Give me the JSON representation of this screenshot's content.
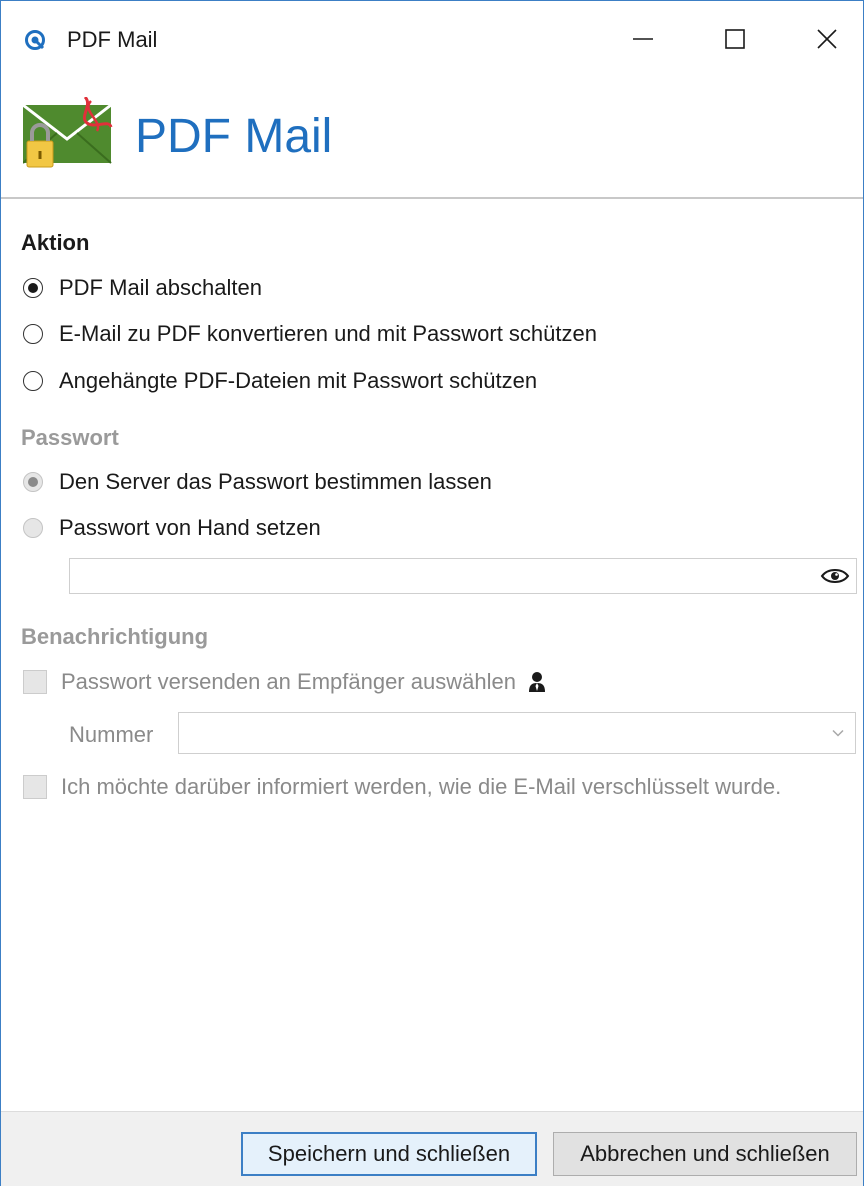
{
  "window": {
    "title": "PDF Mail",
    "controls": {
      "minimize": "minimize-icon",
      "maximize": "maximize-icon",
      "close": "close-icon"
    }
  },
  "header": {
    "title": "PDF Mail",
    "logo_icon": "pdf-mail-logo-icon"
  },
  "aktion": {
    "heading": "Aktion",
    "options": [
      {
        "label": "PDF Mail abschalten",
        "checked": true
      },
      {
        "label": "E-Mail zu PDF konvertieren und mit Passwort schützen",
        "checked": false
      },
      {
        "label": "Angehängte PDF-Dateien mit Passwort schützen",
        "checked": false
      }
    ]
  },
  "passwort": {
    "heading": "Passwort",
    "enabled": false,
    "options": [
      {
        "label": "Den Server das Passwort bestimmen lassen",
        "checked": true
      },
      {
        "label": "Passwort von Hand setzen",
        "checked": false
      }
    ],
    "field_value": "",
    "reveal_icon": "eye-icon"
  },
  "benachrichtigung": {
    "heading": "Benachrichtigung",
    "enabled": false,
    "send_password_label": "Passwort versenden an Empfänger auswählen",
    "send_password_checked": false,
    "recipient_icon": "person-icon",
    "nummer_label": "Nummer",
    "nummer_value": "",
    "inform_label": "Ich möchte darüber informiert werden, wie die E-Mail verschlüsselt wurde.",
    "inform_checked": false
  },
  "footer": {
    "save_label": "Speichern und schließen",
    "cancel_label": "Abbrechen und schließen"
  },
  "colors": {
    "accent": "#1f6fbf",
    "window_border": "#3c7fc5",
    "disabled_text": "#8a8a8a",
    "footer_bg": "#f0f0f0"
  }
}
